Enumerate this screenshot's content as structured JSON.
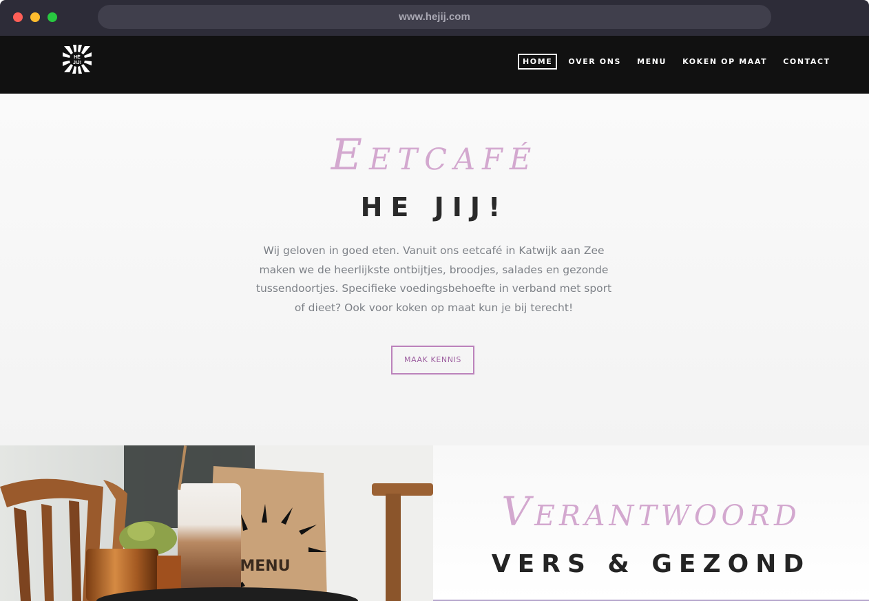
{
  "browser": {
    "url": "www.hejij.com"
  },
  "header": {
    "logo_text": "HÉ JIJ!",
    "nav": [
      {
        "label": "HOME",
        "active": true
      },
      {
        "label": "OVER ONS",
        "active": false
      },
      {
        "label": "MENU",
        "active": false
      },
      {
        "label": "KOKEN OP MAAT",
        "active": false
      },
      {
        "label": "CONTACT",
        "active": false
      }
    ]
  },
  "hero": {
    "script_title": "Eetcafé",
    "title": "HE JIJ!",
    "text": "Wij geloven in goed eten. Vanuit ons eetcafé in Katwijk aan Zee maken we de heerlijkste ontbijtjes, broodjes, salades en gezonde tussendoortjes. Specifieke voedingsbehoefte in verband met sport of dieet? Ook voor koken op maat kun je bij terecht!",
    "button_label": "MAAK KENNIS"
  },
  "feature": {
    "script_title": "Verantwoord",
    "title": "VERS & GEZOND"
  },
  "photo": {
    "menu_card_text": "MENU"
  },
  "colors": {
    "accent": "#d3a8cf",
    "button_border": "#bb82bb",
    "header_bg": "#111111",
    "chrome_bg": "#2d2c38"
  }
}
